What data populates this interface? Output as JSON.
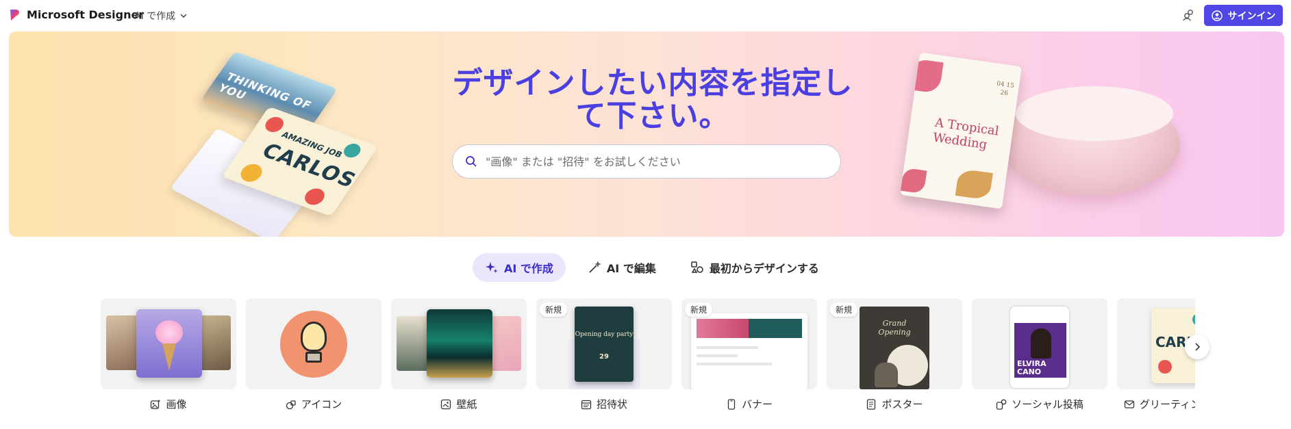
{
  "header": {
    "brand": "Microsoft Designer",
    "create_menu": "AI で作成",
    "signin": "サインイン"
  },
  "hero": {
    "title": "デザインしたい内容を指定して下さい。",
    "search_placeholder": "\"画像\" または \"招待\" をお試しください",
    "art": {
      "card1_text": "THINKING OF YOU",
      "card2_small": "AMAZING JOB",
      "card2_big": "CARLOS",
      "wedding_title": "A Tropical Wedding",
      "wedding_date": "04 15 26"
    }
  },
  "tabs": [
    {
      "label": "AI で作成",
      "icon": "sparkle-icon",
      "active": true
    },
    {
      "label": "AI で編集",
      "icon": "magic-wand-icon",
      "active": false
    },
    {
      "label": "最初からデザインする",
      "icon": "shapes-icon",
      "active": false
    }
  ],
  "cards": [
    {
      "label": "画像",
      "icon": "image-sparkle-icon",
      "badge": ""
    },
    {
      "label": "アイコン",
      "icon": "icon-sparkle-icon",
      "badge": ""
    },
    {
      "label": "壁紙",
      "icon": "wallpaper-icon",
      "badge": ""
    },
    {
      "label": "招待状",
      "icon": "calendar-icon",
      "badge": "新規",
      "thumb_title": "Opening day party",
      "thumb_date": "29"
    },
    {
      "label": "バナー",
      "icon": "phone-icon",
      "badge": "新規"
    },
    {
      "label": "ポスター",
      "icon": "document-icon",
      "badge": "新規",
      "thumb_title": "Grand Opening"
    },
    {
      "label": "ソーシャル投稿",
      "icon": "social-post-icon",
      "badge": "",
      "thumb_title": "ELVIRA CANO"
    },
    {
      "label": "グリーティン",
      "icon": "mail-icon",
      "badge": "",
      "thumb_title": "CARL"
    }
  ],
  "colors": {
    "accent": "#4f46e5",
    "title": "#4a3fe0",
    "active_tab_bg": "#ebe6fb"
  }
}
